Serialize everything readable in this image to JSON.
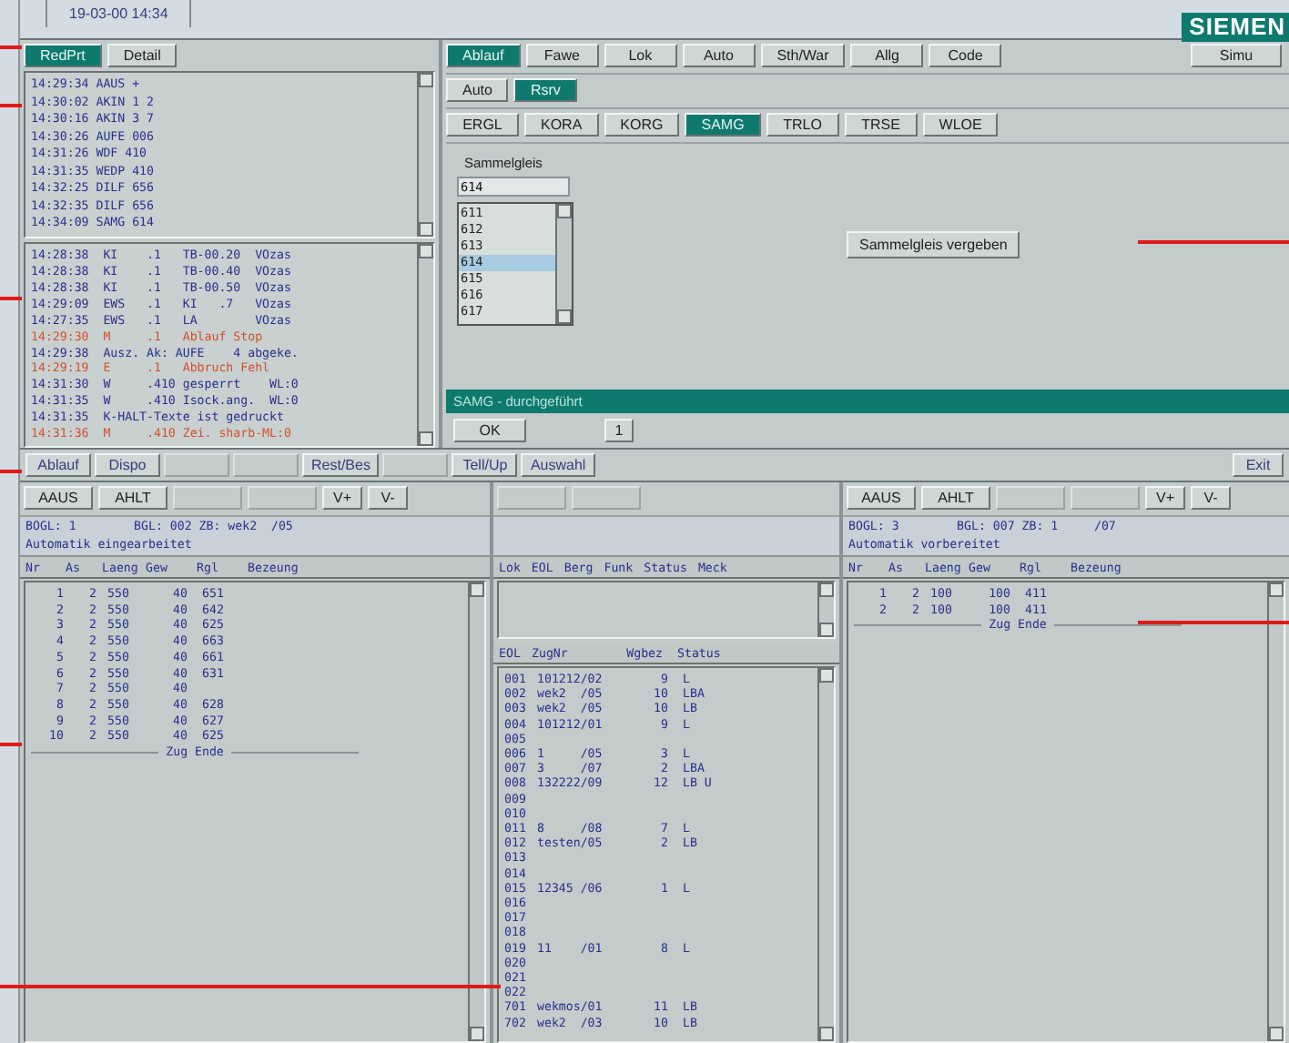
{
  "header": {
    "datetime": "19-03-00  14:34",
    "logo": "SIEMEN"
  },
  "left_top": {
    "buttons": [
      {
        "label": "RedPrt",
        "selected": true
      },
      {
        "label": "Detail",
        "selected": false
      }
    ],
    "event_log": [
      "14:29:34 AAUS +",
      "14:30:02 AKIN 1 2",
      "14:30:16 AKIN 3 7",
      "14:30:26 AUFE 006",
      "14:31:26 WDF 410",
      "14:31:35 WEDP 410",
      "14:32:25 DILF 656",
      "14:32:35 DILF 656",
      "14:34:09 SAMG 614"
    ],
    "message_log": [
      {
        "text": "14:28:38  KI    .1   TB-00.20  VOzas",
        "color": "#27308a"
      },
      {
        "text": "14:28:38  KI    .1   TB-00.40  VOzas",
        "color": "#27308a"
      },
      {
        "text": "14:28:38  KI    .1   TB-00.50  VOzas",
        "color": "#27308a"
      },
      {
        "text": "14:29:09  EWS   .1   KI   .7   VOzas",
        "color": "#27308a"
      },
      {
        "text": "14:27:35  EWS   .1   LA        VOzas",
        "color": "#27308a"
      },
      {
        "text": "14:29:30  M     .1   Ablauf Stop",
        "color": "#d4502e"
      },
      {
        "text": "14:29:38  Ausz. Ak: AUFE    4 abgeke.",
        "color": "#27308a"
      },
      {
        "text": "14:29:19  E     .1   Abbruch Fehl",
        "color": "#d4502e"
      },
      {
        "text": "14:31:30  W     .410 gesperrt    WL:0",
        "color": "#27308a"
      },
      {
        "text": "14:31:35  W     .410 Isock.ang.  WL:0",
        "color": "#27308a"
      },
      {
        "text": "14:31:35  K-HALT-Texte ist gedruckt",
        "color": "#27308a"
      },
      {
        "text": "14:31:36  M     .410 Zei. sharb-ML:0",
        "color": "#d4502e"
      }
    ]
  },
  "main_tabs": [
    {
      "label": "Ablauf",
      "selected": true
    },
    {
      "label": "Fawe",
      "selected": false
    },
    {
      "label": "Lok",
      "selected": false
    },
    {
      "label": "Auto",
      "selected": false
    },
    {
      "label": "Sth/War",
      "selected": false
    },
    {
      "label": "Allg",
      "selected": false
    },
    {
      "label": "Code",
      "selected": false
    }
  ],
  "simu_button": "Simu",
  "mode_tabs": [
    {
      "label": "Auto",
      "selected": false
    },
    {
      "label": "Rsrv",
      "selected": true
    }
  ],
  "function_tabs": [
    {
      "label": "ERGL",
      "selected": false
    },
    {
      "label": "KORA",
      "selected": false
    },
    {
      "label": "KORG",
      "selected": false
    },
    {
      "label": "SAMG",
      "selected": true
    },
    {
      "label": "TRLO",
      "selected": false
    },
    {
      "label": "TRSE",
      "selected": false
    },
    {
      "label": "WLOE",
      "selected": false
    }
  ],
  "sammelgleis": {
    "label": "Sammelgleis",
    "value": "614",
    "options": [
      {
        "label": "611",
        "selected": false
      },
      {
        "label": "612",
        "selected": false
      },
      {
        "label": "613",
        "selected": false
      },
      {
        "label": "614",
        "selected": true
      },
      {
        "label": "615",
        "selected": false
      },
      {
        "label": "616",
        "selected": false
      },
      {
        "label": "617",
        "selected": false
      }
    ],
    "assign_button": "Sammelgleis vergeben"
  },
  "status_message": "SAMG - durchgeführt",
  "dialog_buttons": [
    "OK",
    "1"
  ],
  "toolbar": [
    {
      "label": "Ablauf",
      "disabled": false
    },
    {
      "label": "Dispo",
      "disabled": false
    },
    {
      "disabled": true
    },
    {
      "disabled": true
    },
    {
      "label": "Rest/Bes",
      "disabled": false
    },
    {
      "disabled": true
    },
    {
      "label": "Tell/Up",
      "disabled": false
    },
    {
      "label": "Auswahl",
      "disabled": false
    }
  ],
  "exit_button": "Exit",
  "left_panel": {
    "buttons": [
      {
        "label": "AAUS",
        "disabled": false
      },
      {
        "label": "AHLT",
        "disabled": false
      },
      {
        "disabled": true
      },
      {
        "disabled": true
      },
      {
        "label": "V+",
        "disabled": false
      },
      {
        "label": "V-",
        "disabled": false
      }
    ],
    "info": [
      "BOGL: 1        BGL: 002 ZB: wek2  /05",
      "Automatik eingearbeitet"
    ],
    "columns": [
      "Nr",
      "As",
      "Laeng",
      "Gew",
      "Rgl",
      "Bezeung"
    ],
    "rows": [
      [
        "1",
        "2",
        "550",
        "40",
        "651"
      ],
      [
        "2",
        "2",
        "550",
        "40",
        "642"
      ],
      [
        "3",
        "2",
        "550",
        "40",
        "625"
      ],
      [
        "4",
        "2",
        "550",
        "40",
        "663"
      ],
      [
        "5",
        "2",
        "550",
        "40",
        "661"
      ],
      [
        "6",
        "2",
        "550",
        "40",
        "631"
      ],
      [
        "7",
        "2",
        "550",
        "40"
      ],
      [
        "8",
        "2",
        "550",
        "40",
        "628"
      ],
      [
        "9",
        "2",
        "550",
        "40",
        "627"
      ],
      [
        "10",
        "2",
        "550",
        "40",
        "625"
      ]
    ],
    "end_marker": "Zug Ende"
  },
  "middle_panel": {
    "buttons": [
      {
        "disabled": true
      },
      {
        "disabled": true
      }
    ],
    "loco_columns": [
      "Lok",
      "EOL",
      "Berg",
      "Funk",
      "Status",
      "Meck"
    ],
    "columns": [
      "EOL",
      "ZugNr",
      "Wgbez",
      "Status"
    ],
    "rows": [
      [
        "001",
        "101212/02",
        "9",
        "L"
      ],
      [
        "002",
        "wek2  /05",
        "10",
        "LBA"
      ],
      [
        "003",
        "wek2  /05",
        "10",
        "LB"
      ],
      [
        "004",
        "101212/01",
        "9",
        "L"
      ],
      [
        "005"
      ],
      [
        "006",
        "1     /05",
        "3",
        "L"
      ],
      [
        "007",
        "3     /07",
        "2",
        "LBA"
      ],
      [
        "008",
        "132222/09",
        "12",
        "LB U"
      ],
      [
        "009"
      ],
      [
        "010"
      ],
      [
        "011",
        "8     /08",
        "7",
        "L"
      ],
      [
        "012",
        "testen/05",
        "2",
        "LB"
      ],
      [
        "013"
      ],
      [
        "014"
      ],
      [
        "015",
        "12345 /06",
        "1",
        "L"
      ],
      [
        "016"
      ],
      [
        "017"
      ],
      [
        "018"
      ],
      [
        "019",
        "11    /01",
        "8",
        "L"
      ],
      [
        "020"
      ],
      [
        "021"
      ],
      [
        "022"
      ],
      [
        "701",
        "wekmos/01",
        "11",
        "LB"
      ],
      [
        "702",
        "wek2  /03",
        "10",
        "LB"
      ]
    ]
  },
  "right_panel": {
    "buttons": [
      {
        "label": "AAUS",
        "disabled": false
      },
      {
        "label": "AHLT",
        "disabled": false
      },
      {
        "disabled": true
      },
      {
        "disabled": true
      },
      {
        "label": "V+",
        "disabled": false
      },
      {
        "label": "V-",
        "disabled": false
      }
    ],
    "info": [
      "BOGL: 3        BGL: 007 ZB: 1     /07",
      "Automatik vorbereitet"
    ],
    "columns": [
      "Nr",
      "As",
      "Laeng",
      "Gew",
      "Rgl",
      "Bezeung"
    ],
    "rows": [
      [
        "1",
        "2",
        "100",
        "100",
        "411"
      ],
      [
        "2",
        "2",
        "100",
        "100",
        "411"
      ]
    ],
    "end_marker": "Zug Ende"
  }
}
